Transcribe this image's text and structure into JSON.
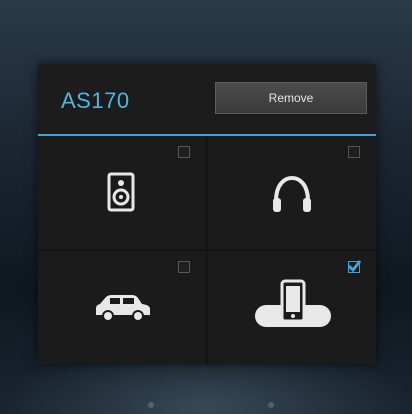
{
  "device": {
    "name": "AS170"
  },
  "header": {
    "remove_label": "Remove"
  },
  "outputs": [
    {
      "icon": "speaker-icon",
      "checked": false
    },
    {
      "icon": "headphones-icon",
      "checked": false
    },
    {
      "icon": "car-icon",
      "checked": false
    },
    {
      "icon": "phone-dock-icon",
      "checked": true
    }
  ],
  "colors": {
    "accent": "#3da6d6",
    "panel": "#1b1b1b"
  }
}
